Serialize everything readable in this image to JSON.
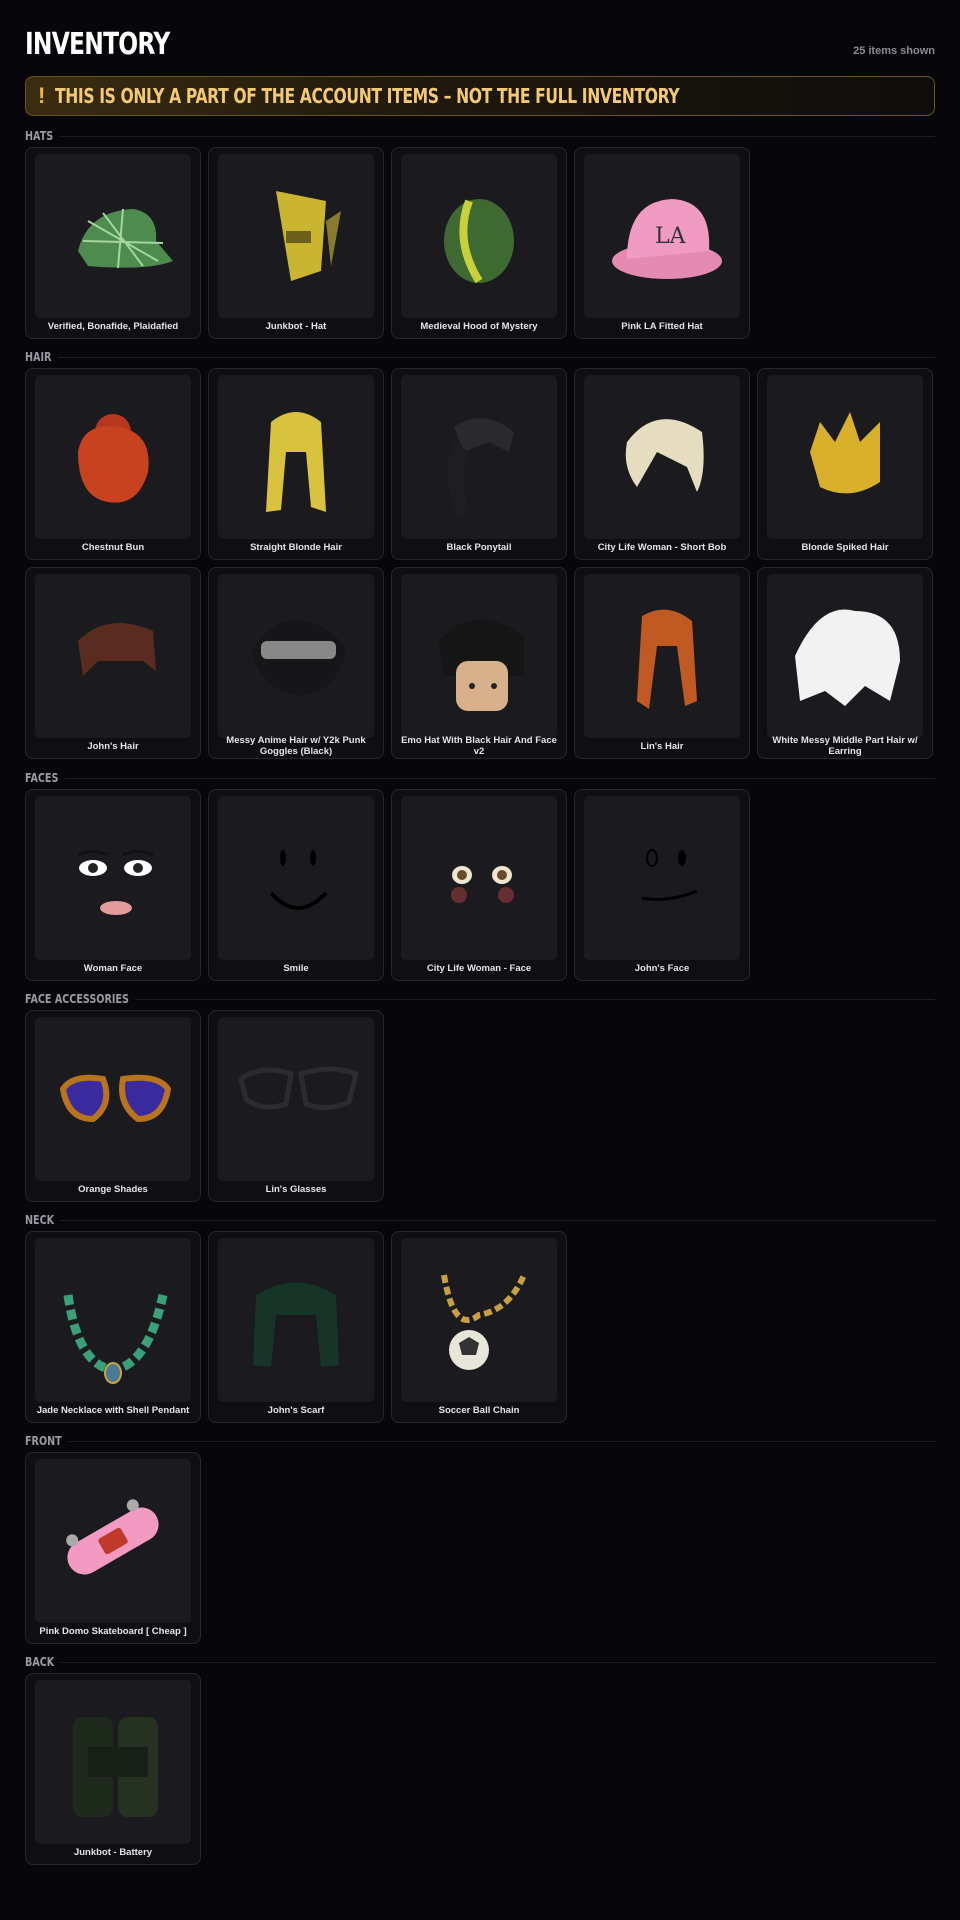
{
  "header": {
    "title": "INVENTORY",
    "count": "25 items shown"
  },
  "banner": {
    "icon": "!",
    "text": "THIS IS ONLY A PART OF THE ACCOUNT ITEMS – NOT THE FULL INVENTORY"
  },
  "sections": {
    "hats": {
      "label": "HATS",
      "items": [
        {
          "name": "Verified, Bonafide, Plaidafied",
          "icon": "plaid-cap"
        },
        {
          "name": "Junkbot - Hat",
          "icon": "junkbot-hat"
        },
        {
          "name": "Medieval Hood of Mystery",
          "icon": "hood"
        },
        {
          "name": "Pink LA Fitted Hat",
          "icon": "pink-cap"
        }
      ]
    },
    "hair": {
      "label": "HAIR",
      "items": [
        {
          "name": "Chestnut Bun",
          "icon": "hair-bun"
        },
        {
          "name": "Straight Blonde Hair",
          "icon": "hair-straight"
        },
        {
          "name": "Black Ponytail",
          "icon": "hair-ponytail"
        },
        {
          "name": "City Life Woman - Short Bob",
          "icon": "hair-bob"
        },
        {
          "name": "Blonde Spiked Hair",
          "icon": "hair-spiked"
        },
        {
          "name": "John's Hair",
          "icon": "hair-short"
        },
        {
          "name": "Messy Anime Hair w/ Y2k Punk Goggles (Black)",
          "icon": "hair-goggles"
        },
        {
          "name": "Emo Hat With Black Hair And Face v2",
          "icon": "hair-emo"
        },
        {
          "name": "Lin's Hair",
          "icon": "hair-long"
        },
        {
          "name": "White Messy Middle Part Hair w/ Earring",
          "icon": "hair-white"
        }
      ]
    },
    "faces": {
      "label": "FACES",
      "items": [
        {
          "name": "Woman Face",
          "icon": "face-woman"
        },
        {
          "name": "Smile",
          "icon": "face-smile"
        },
        {
          "name": "City Life Woman - Face",
          "icon": "face-city"
        },
        {
          "name": "John's Face",
          "icon": "face-john"
        }
      ]
    },
    "face_accessories": {
      "label": "FACE ACCESSORIES",
      "items": [
        {
          "name": "Orange Shades",
          "icon": "shades"
        },
        {
          "name": "Lin's Glasses",
          "icon": "glasses"
        }
      ]
    },
    "neck": {
      "label": "NECK",
      "items": [
        {
          "name": "Jade Necklace with Shell Pendant",
          "icon": "necklace"
        },
        {
          "name": "John's Scarf",
          "icon": "scarf"
        },
        {
          "name": "Soccer Ball Chain",
          "icon": "chain"
        }
      ]
    },
    "front": {
      "label": "FRONT",
      "items": [
        {
          "name": "Pink Domo Skateboard [ Cheap ]",
          "icon": "skateboard"
        }
      ]
    },
    "back": {
      "label": "BACK",
      "items": [
        {
          "name": "Junkbot - Battery",
          "icon": "battery"
        }
      ]
    }
  }
}
